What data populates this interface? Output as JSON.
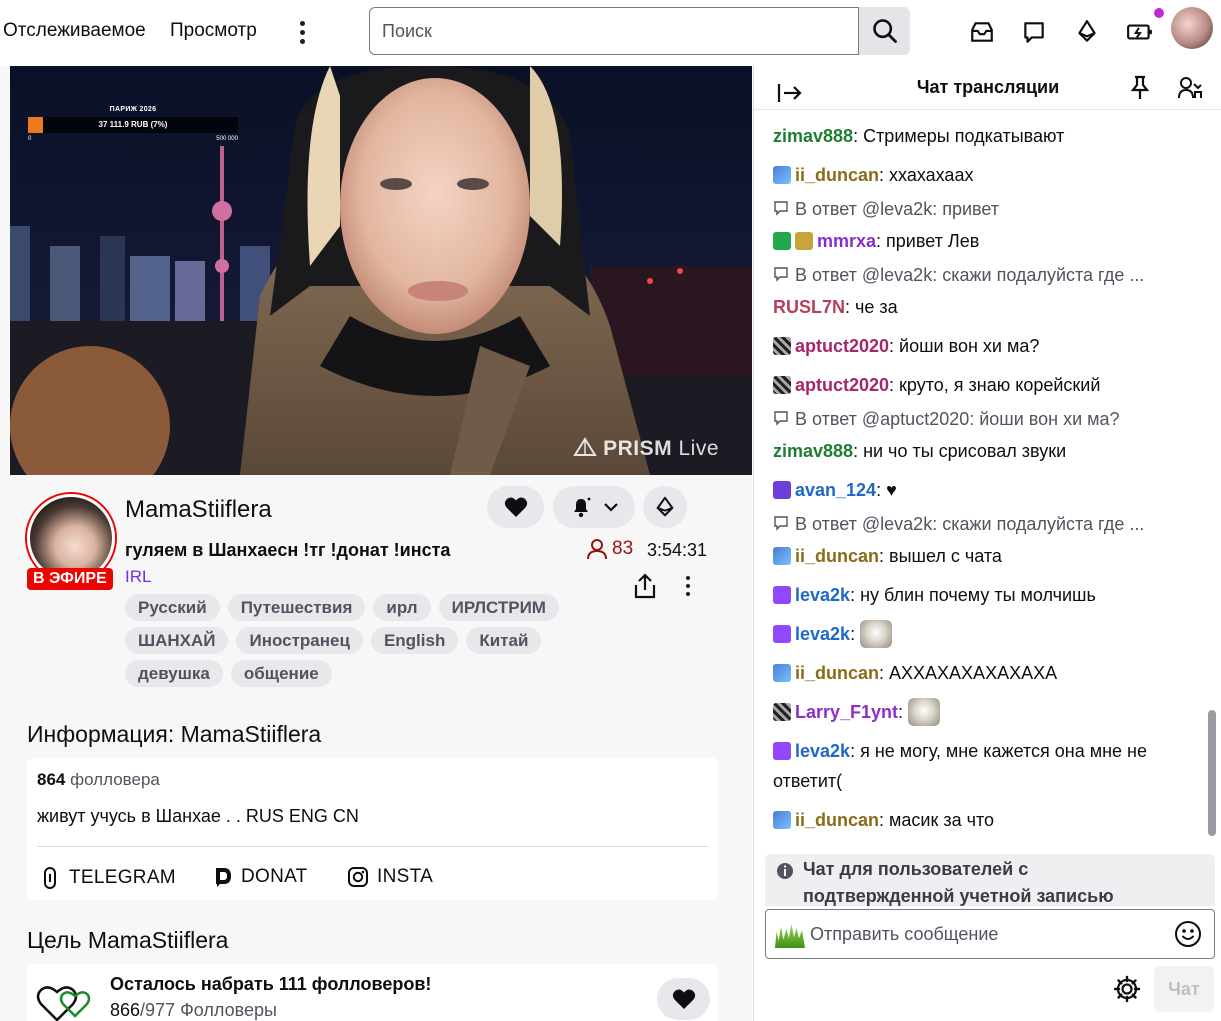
{
  "nav": {
    "following": "Отслеживаемое",
    "browse": "Просмотр",
    "search_placeholder": "Поиск"
  },
  "video": {
    "goal_title": "ПАРИЖ 2026",
    "goal_value": "37 111.9 RUB (7%)",
    "goal_progress": 0.07,
    "goal_min": "0",
    "goal_max": "500 000",
    "watermark_bold": "PRISM",
    "watermark_light": " Live"
  },
  "channel": {
    "live_badge": "В ЭФИРЕ",
    "name": "MamaStiiflera",
    "title": "гуляем в Шанхаеcн !тг !донат !инста",
    "category": "IRL",
    "viewers": "83",
    "uptime": "3:54:31",
    "tags": [
      "Русский",
      "Путешествия",
      "ирл",
      "ИРЛСТРИМ",
      "ШАНХАЙ",
      "Иностранец",
      "English",
      "Китай",
      "девушка",
      "общение"
    ]
  },
  "about": {
    "heading_prefix": "Информация: ",
    "heading_name": "MamaStiiflera",
    "followers_count": "864",
    "followers_label": " фолловера",
    "bio": "живут учусь в Шанхае .    . RUS ENG CN",
    "links": [
      "TELEGRAM",
      "DONAT",
      "INSTA"
    ]
  },
  "goal": {
    "heading_prefix": "Цель ",
    "heading_name": "MamaStiiflera",
    "text": "Осталось набрать 111 фолловеров!",
    "current": "866",
    "total_suffix": "/977 Фолловеры"
  },
  "chat": {
    "title": "Чат трансляции",
    "messages": [
      {
        "kind": "msg",
        "user": "zimav888",
        "color": "#1e7e34",
        "text": ": Стримеры подкатывают"
      },
      {
        "kind": "msg",
        "user": "ii_duncan",
        "color": "#8a6d1a",
        "text": ": ххахахаах"
      },
      {
        "kind": "reply",
        "text": "В ответ @leva2k: привет"
      },
      {
        "kind": "msg",
        "user": "mmrxa",
        "color": "#8b2fc9",
        "text": ": привет Лев"
      },
      {
        "kind": "reply",
        "text": "В ответ @leva2k: скажи подалуйста где ..."
      },
      {
        "kind": "msg",
        "user": "RUSL7N",
        "color": "#b5405b",
        "text": ": че за"
      },
      {
        "kind": "msg",
        "user": "aptuct2020",
        "color": "#a6266b",
        "text": ": йоши вон хи ма?"
      },
      {
        "kind": "msg",
        "user": "aptuct2020",
        "color": "#a6266b",
        "text": ": круто, я знаю корейский"
      },
      {
        "kind": "reply",
        "text": "В ответ @aptuct2020: йоши вон хи ма?"
      },
      {
        "kind": "msg",
        "user": "zimav888",
        "color": "#1e7e34",
        "text": ": ни чо ты срисовал звуки"
      },
      {
        "kind": "msg",
        "user": "avan_124",
        "color": "#1f69c6",
        "text": ": ♥"
      },
      {
        "kind": "reply",
        "text": "В ответ @leva2k: скажи подалуйста где ..."
      },
      {
        "kind": "msg",
        "user": "ii_duncan",
        "color": "#8a6d1a",
        "text": ": вышел с чата"
      },
      {
        "kind": "msg",
        "user": "leva2k",
        "color": "#1f69c6",
        "text": ": ну блин почему ты молчишь"
      },
      {
        "kind": "msg",
        "user": "leva2k",
        "color": "#1f69c6",
        "text": ": "
      },
      {
        "kind": "msg",
        "user": "ii_duncan",
        "color": "#8a6d1a",
        "text": ": АХХАХАХАХАХАХА"
      },
      {
        "kind": "msg",
        "user": "Larry_F1ynt",
        "color": "#8b2fc9",
        "text": ": "
      },
      {
        "kind": "msg",
        "user": "leva2k",
        "color": "#1f69c6",
        "text": ": я не могу, мне кажется она мне не ответит("
      },
      {
        "kind": "msg",
        "user": "ii_duncan",
        "color": "#8a6d1a",
        "text": ": масик за что"
      }
    ],
    "notice": "Чат для пользователей с подтвержденной учетной записью",
    "input_placeholder": "Отправить сообщение",
    "send_label": "Чат"
  },
  "colors": {
    "accent": "#772ce8",
    "live_red": "#eb0400",
    "viewer_red": "#971311"
  }
}
